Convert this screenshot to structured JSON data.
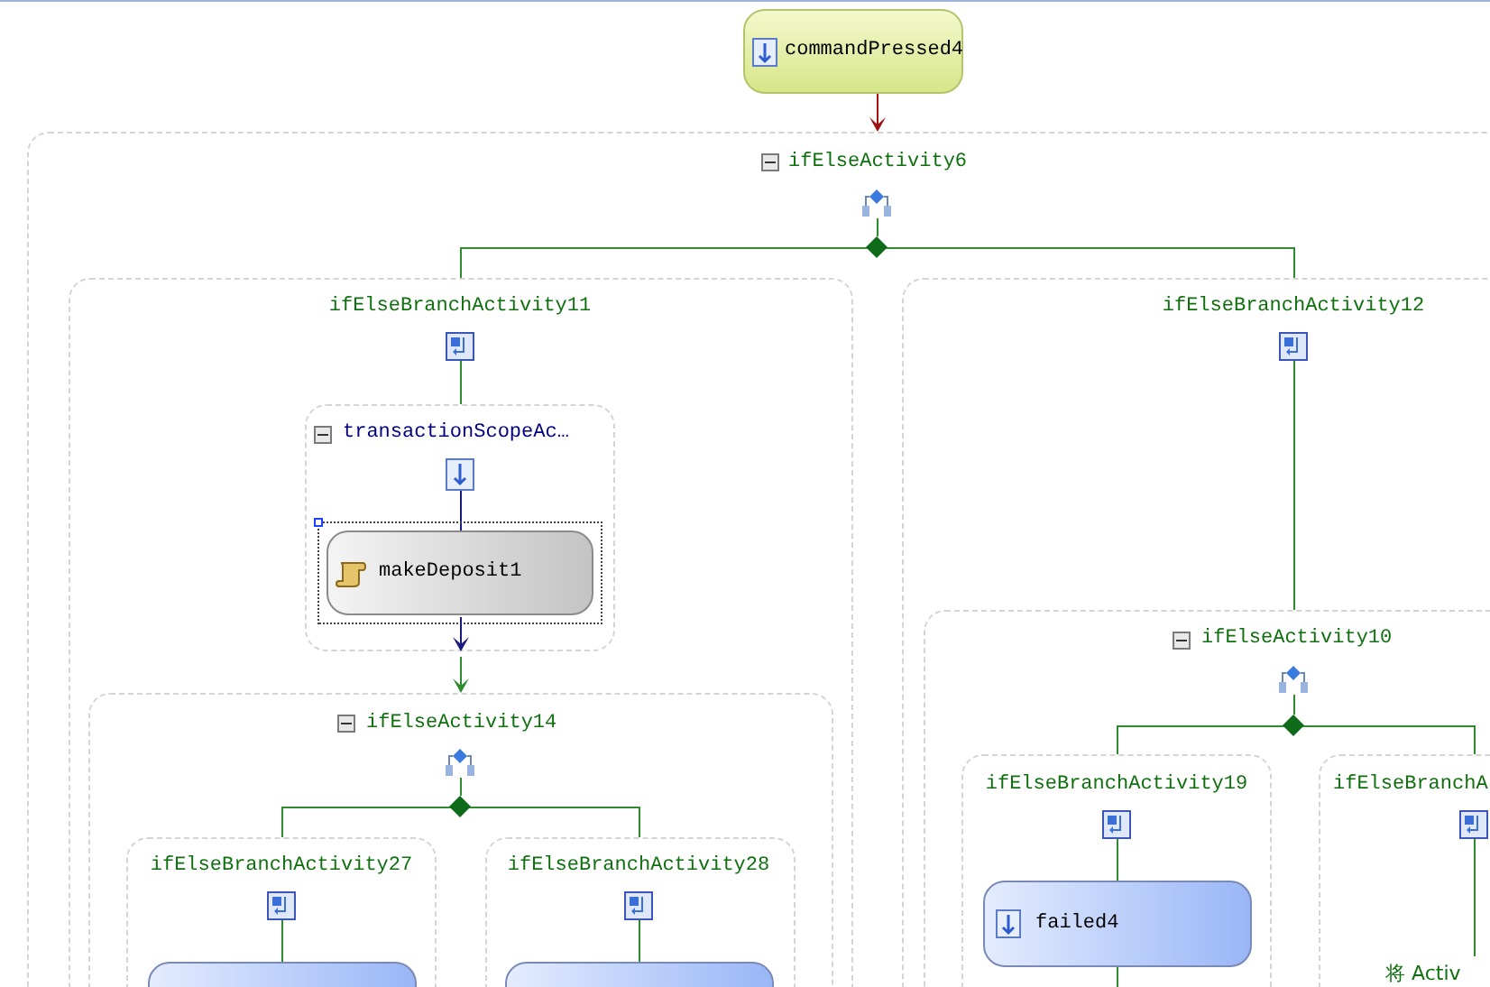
{
  "top_activity": {
    "label": "commandPressed4"
  },
  "if_else": {
    "title": "ifElseActivity6",
    "expanded": true,
    "branches": [
      {
        "title": "ifElseBranchActivity11",
        "scope": {
          "title": "transactionScopeAc…",
          "expanded": true,
          "activity": {
            "label": "makeDeposit1",
            "selected": true
          }
        },
        "if_else": {
          "title": "ifElseActivity14",
          "expanded": true,
          "branches": [
            {
              "title": "ifElseBranchActivity27"
            },
            {
              "title": "ifElseBranchActivity28"
            }
          ]
        }
      },
      {
        "title": "ifElseBranchActivity12",
        "if_else": {
          "title": "ifElseActivity10",
          "expanded": true,
          "branches": [
            {
              "title": "ifElseBranchActivity19",
              "activity": {
                "label": "failed4"
              }
            },
            {
              "title": "ifElseBranchA",
              "note": "将 Activ"
            }
          ]
        }
      }
    ]
  }
}
